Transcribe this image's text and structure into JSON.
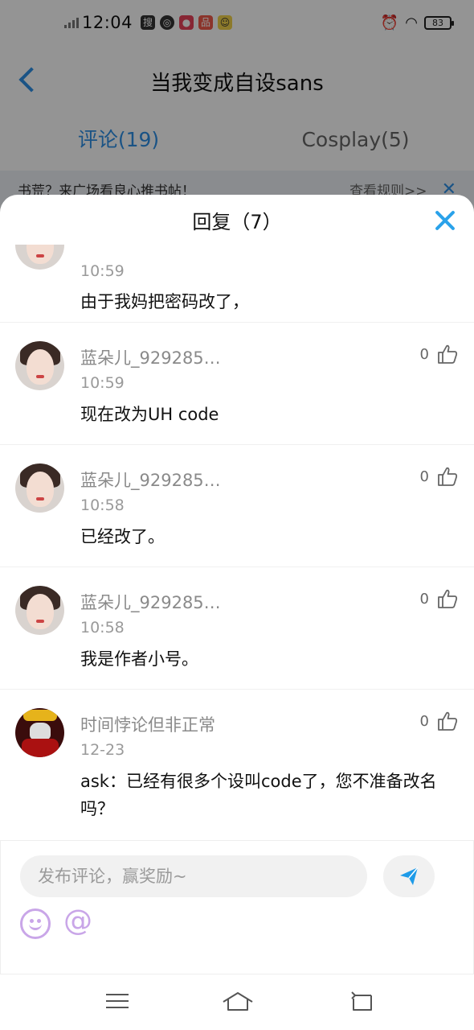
{
  "status_bar": {
    "time": "12:04",
    "battery": "83",
    "icons": [
      "search-app-icon",
      "compass-icon",
      "app-icon-red",
      "app-icon-red-2",
      "app-icon-yellow",
      "alarm-icon",
      "wifi-icon",
      "battery-icon"
    ]
  },
  "header": {
    "title": "当我变成自设sans"
  },
  "tabs": [
    {
      "label": "评论(19)"
    },
    {
      "label": "Cosplay(5)"
    }
  ],
  "notice": {
    "text": "书荒？来广场看良心推书帖！",
    "rules": "查看规则>>"
  },
  "sheet": {
    "title": "回复（7）"
  },
  "comments": [
    {
      "name": "",
      "time": "10:59",
      "content": "由于我妈把密码改了，",
      "likes": ""
    },
    {
      "name": "蓝朵儿_929285…",
      "time": "10:59",
      "content": "现在改为UH   code",
      "likes": "0"
    },
    {
      "name": "蓝朵儿_929285…",
      "time": "10:58",
      "content": "已经改了。",
      "likes": "0"
    },
    {
      "name": "蓝朵儿_929285…",
      "time": "10:58",
      "content": "我是作者小号。",
      "likes": "0"
    },
    {
      "name": "时间悖论但非正常",
      "time": "12-23",
      "content": "ask：已经有很多个设叫code了，您不准备改名吗？",
      "likes": "0"
    }
  ],
  "composer": {
    "placeholder": "发布评论，赢奖励~",
    "at_symbol": "@"
  },
  "colors": {
    "accent": "#2e8fe6",
    "close": "#2aa2ea",
    "send": "#1e9be8",
    "emoji": "#c9a6e8"
  }
}
